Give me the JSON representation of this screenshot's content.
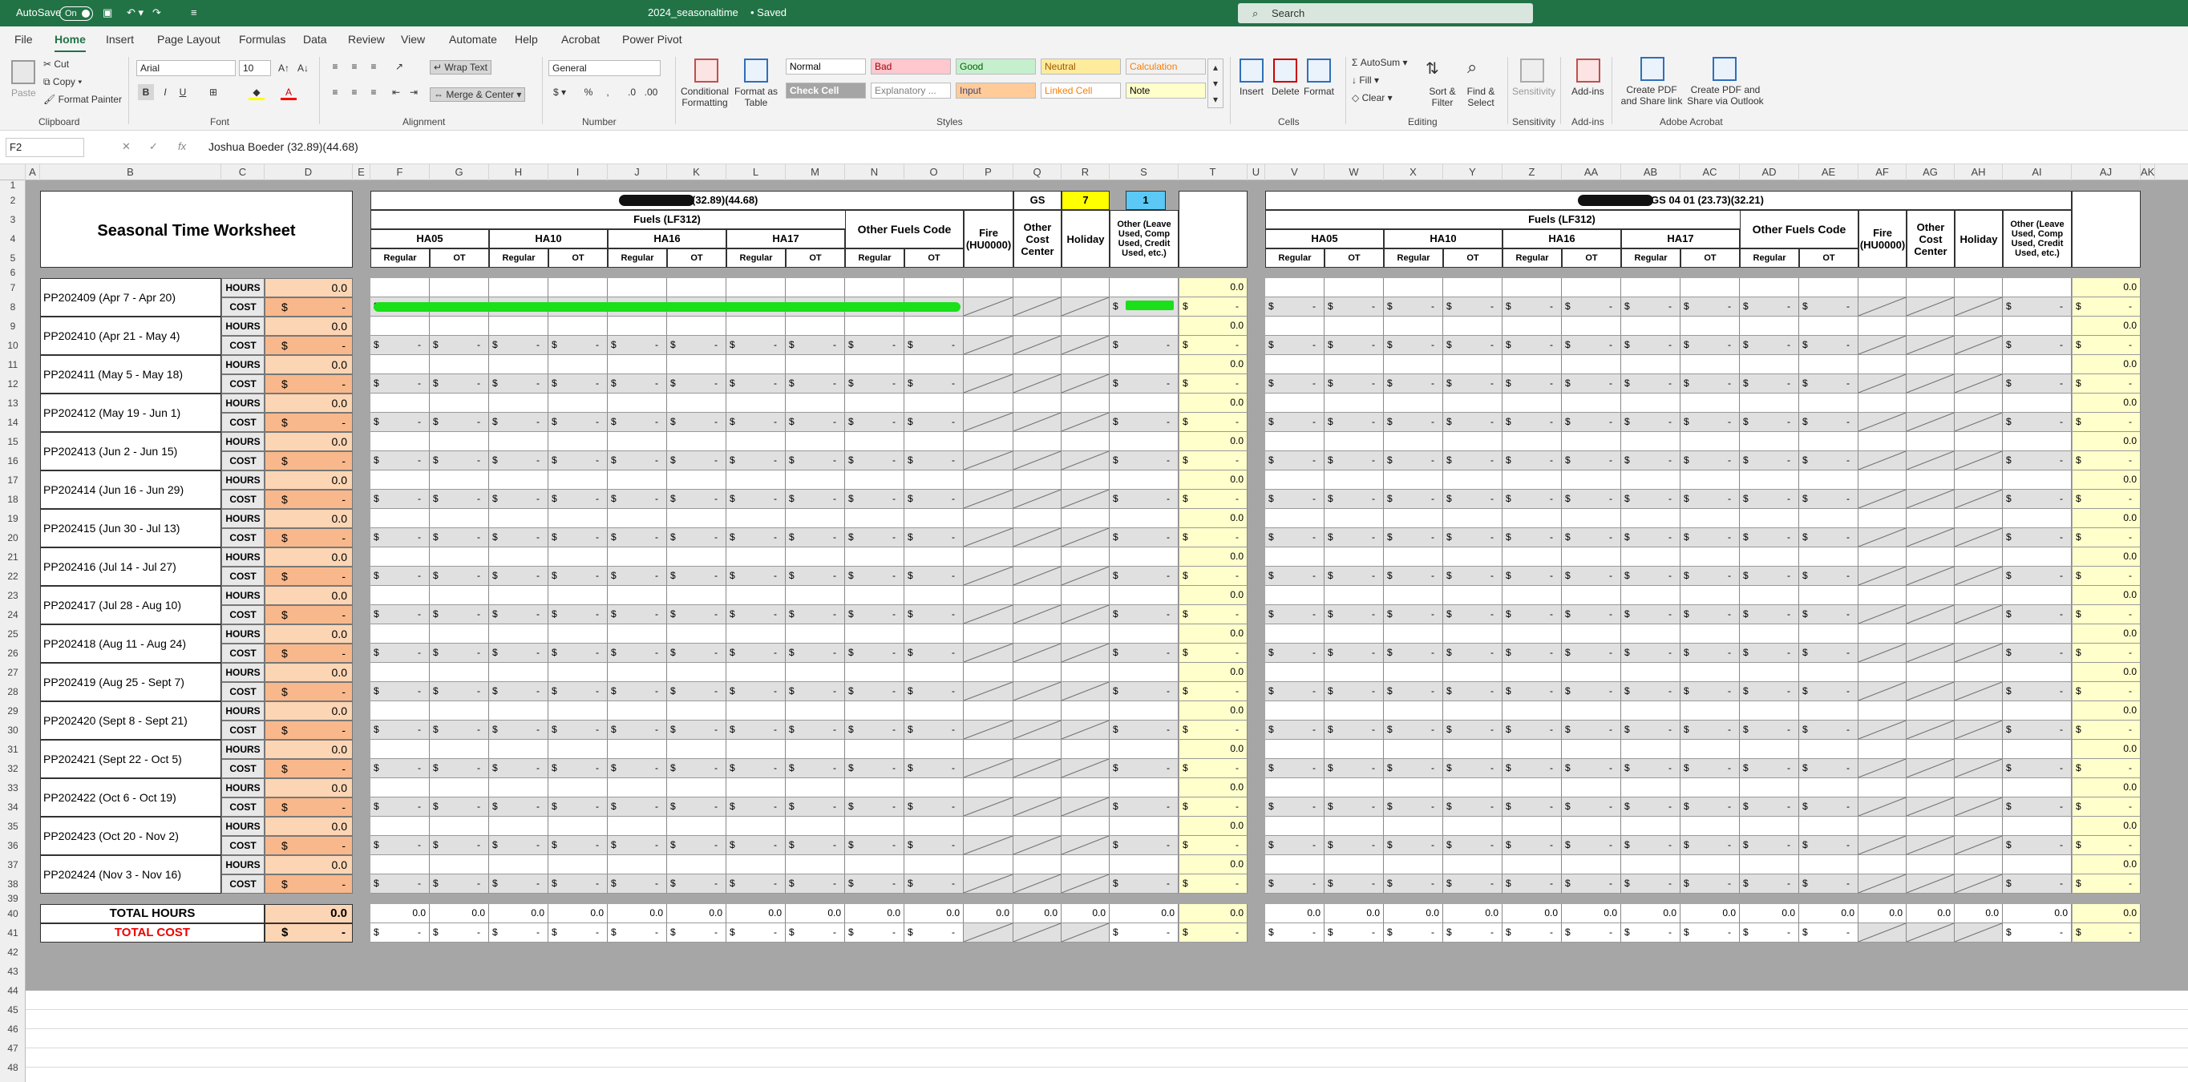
{
  "title_bar": {
    "autosave": "AutoSave",
    "toggle": "On",
    "filename": "2024_seasonaltime",
    "saved": "• Saved",
    "search": "Search"
  },
  "menu": [
    "File",
    "Home",
    "Insert",
    "Page Layout",
    "Formulas",
    "Data",
    "Review",
    "View",
    "Automate",
    "Help",
    "Acrobat",
    "Power Pivot"
  ],
  "ribbon": {
    "clipboard": {
      "paste": "Paste",
      "cut": "Cut",
      "copy": "Copy",
      "format_painter": "Format Painter",
      "label": "Clipboard"
    },
    "font": {
      "name": "Arial",
      "size": "10",
      "label": "Font"
    },
    "alignment": {
      "wrap": "Wrap Text",
      "merge": "Merge & Center",
      "label": "Alignment"
    },
    "number": {
      "format": "General",
      "label": "Number"
    },
    "styles": {
      "cond": "Conditional Formatting",
      "fmt_table": "Format as Table",
      "label": "Styles",
      "cells": [
        {
          "t": "Normal",
          "bg": "#ffffff",
          "fg": "#000000"
        },
        {
          "t": "Bad",
          "bg": "#ffc7ce",
          "fg": "#9c0006"
        },
        {
          "t": "Good",
          "bg": "#c6efce",
          "fg": "#006100"
        },
        {
          "t": "Neutral",
          "bg": "#ffeb9c",
          "fg": "#9c5700"
        },
        {
          "t": "Calculation",
          "bg": "#f2f2f2",
          "fg": "#fa7d00"
        },
        {
          "t": "Check Cell",
          "bg": "#a5a5a5",
          "fg": "#ffffff"
        },
        {
          "t": "Explanatory ...",
          "bg": "#ffffff",
          "fg": "#7f7f7f"
        },
        {
          "t": "Input",
          "bg": "#ffcc99",
          "fg": "#3f3f76"
        },
        {
          "t": "Linked Cell",
          "bg": "#ffffff",
          "fg": "#fa7d00"
        },
        {
          "t": "Note",
          "bg": "#ffffcc",
          "fg": "#000000"
        }
      ]
    },
    "cells": {
      "insert": "Insert",
      "delete": "Delete",
      "format": "Format",
      "label": "Cells"
    },
    "editing": {
      "autosum": "AutoSum",
      "fill": "Fill",
      "clear": "Clear",
      "sort": "Sort & Filter",
      "find": "Find & Select",
      "label": "Editing"
    },
    "sensitivity": {
      "btn": "Sensitivity",
      "label": "Sensitivity"
    },
    "addins": {
      "btn": "Add-ins",
      "label": "Add-ins"
    },
    "acrobat": {
      "pdf_share": "Create PDF and Share link",
      "pdf_outlook": "Create PDF and Share via Outlook",
      "label": "Adobe Acrobat"
    }
  },
  "formula_bar": {
    "name_box": "F2",
    "content": "Joshua Boeder (32.89)(44.68)"
  },
  "columns": [
    "A",
    "B",
    "C",
    "D",
    "E",
    "F",
    "G",
    "H",
    "I",
    "J",
    "K",
    "L",
    "M",
    "N",
    "O",
    "P",
    "Q",
    "R",
    "S",
    "T",
    "U",
    "V",
    "W",
    "X",
    "Y",
    "Z",
    "AA",
    "AB",
    "AC",
    "AD",
    "AE",
    "AF",
    "AG",
    "AH",
    "AI",
    "AJ",
    "AK"
  ],
  "worksheet": {
    "title": "Seasonal Time Worksheet",
    "hours_label": "HOURS",
    "cost_label": "COST",
    "dollar": "$",
    "zero": "0.0",
    "dash": "-",
    "total_hours": "TOTAL HOURS",
    "total_cost": "TOTAL COST",
    "periods": [
      "PP202409 (Apr 7 - Apr 20)",
      "PP202410 (Apr 21 - May 4)",
      "PP202411 (May 5 - May 18)",
      "PP202412 (May 19 - Jun 1)",
      "PP202413 (Jun 2 - Jun 15)",
      "PP202414 (Jun 16 - Jun 29)",
      "PP202415 (Jun 30 - Jul 13)",
      "PP202416 (Jul 14 - Jul 27)",
      "PP202417 (Jul 28 - Aug 10)",
      "PP202418 (Aug 11 - Aug 24)",
      "PP202419 (Aug 25 - Sept 7)",
      "PP202420 (Sept 8 - Sept 21)",
      "PP202421 (Sept 22 - Oct 5)",
      "PP202422 (Oct 6 - Oct 19)",
      "PP202423 (Oct 20 - Nov 2)",
      "PP202424 (Nov 3 - Nov 16)"
    ],
    "employee1": "(32.89)(44.68)",
    "gs_label": "GS",
    "gs_value": "7",
    "step_value": "1",
    "employee2": "GS 04 01 (23.73)(32.21)",
    "fuels": "Fuels (LF312)",
    "ha": [
      "HA05",
      "HA10",
      "HA16",
      "HA17"
    ],
    "other_fuels": "Other Fuels Code",
    "fire": "Fire (HU0000)",
    "other_cc": "Other Cost Center",
    "holiday": "Holiday",
    "other_leave": "Other (Leave Used, Comp Used, Credit Used, etc.)",
    "regular": "Regular",
    "ot": "OT"
  },
  "colors": {
    "excel_green": "#217346",
    "hours_fill": "#fcd5b4",
    "cost_fill": "#f8b88b",
    "total_fill": "#ffffcc",
    "gs_yellow": "#ffff00",
    "step_blue": "#5bc8f5",
    "highlight": "#19e019"
  }
}
